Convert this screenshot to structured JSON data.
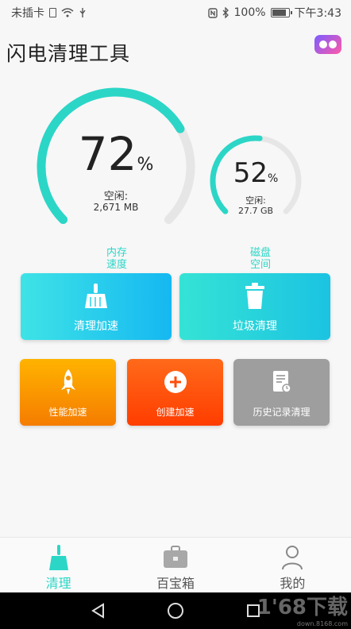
{
  "status_bar": {
    "carrier": "未插卡",
    "battery": "100%",
    "time": "下午3:43",
    "icons": [
      "sim-icon",
      "wifi-icon",
      "usb-icon",
      "nfc-icon",
      "bluetooth-icon",
      "battery-icon"
    ]
  },
  "app": {
    "title": "闪电清理工具"
  },
  "memory_gauge": {
    "percent_value": 72,
    "percent_text": "72",
    "percent_sign": "%",
    "free_label": "空闲:",
    "free_value": "2,671 MB",
    "caption": "内存\n速度",
    "caption_line1": "内存",
    "caption_line2": "速度"
  },
  "disk_gauge": {
    "percent_value": 52,
    "percent_text": "52",
    "percent_sign": "%",
    "free_label": "空闲:",
    "free_value": "27.7 GB",
    "caption_line1": "磁盘",
    "caption_line2": "空间"
  },
  "actions": {
    "clean_speed": "清理加速",
    "junk_clean": "垃圾清理",
    "perf_speed": "性能加速",
    "create_speed": "创建加速",
    "history_clean": "历史记录清理"
  },
  "bottom_nav": {
    "clean": "清理",
    "toolbox": "百宝箱",
    "mine": "我的"
  },
  "watermark": {
    "main": "1'68下载",
    "sub": "down.8168.com"
  },
  "colors": {
    "accent": "#2bd6c7",
    "track": "#e6e6e6"
  }
}
